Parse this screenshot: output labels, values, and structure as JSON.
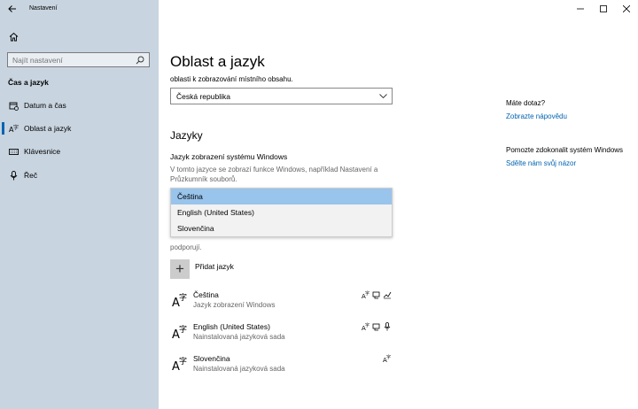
{
  "window": {
    "title": "Nastavení"
  },
  "sidebar": {
    "search_placeholder": "Najít nastavení",
    "section": "Čas a jazyk",
    "items": [
      {
        "label": "Datum a čas",
        "icon": "calendar-clock-icon"
      },
      {
        "label": "Oblast a jazyk",
        "icon": "language-icon"
      },
      {
        "label": "Klávesnice",
        "icon": "keyboard-icon"
      },
      {
        "label": "Řeč",
        "icon": "microphone-icon"
      }
    ]
  },
  "main": {
    "title": "Oblast a jazyk",
    "region_label": "oblasti k zobrazování místního obsahu.",
    "region_value": "Česká republika",
    "languages_heading": "Jazyky",
    "display_lang_label": "Jazyk zobrazení systému Windows",
    "display_lang_desc": "V tomto jazyce se zobrazí funkce Windows, například Nastavení a Průzkumník souborů.",
    "dropdown_options": [
      "Čeština",
      "English (United States)",
      "Slovenčina"
    ],
    "dropdown_selected": "Čeština",
    "partial_line_1": "podporují.",
    "add_language": "Přidat jazyk",
    "languages": [
      {
        "name": "Čeština",
        "status": "Jazyk zobrazení Windows"
      },
      {
        "name": "English (United States)",
        "status": "Nainstalovaná jazyková sada"
      },
      {
        "name": "Slovenčina",
        "status": "Nainstalovaná jazyková sada"
      }
    ]
  },
  "aside": {
    "question": "Máte dotaz?",
    "help_link": "Zobrazte nápovědu",
    "improve_text": "Pomozte zdokonalit systém Windows",
    "feedback_link": "Sdělte nám svůj názor"
  },
  "colors": {
    "sidebar_bg": "#c8d4e0",
    "accent": "#0063b1",
    "selection": "#99c4ec"
  }
}
